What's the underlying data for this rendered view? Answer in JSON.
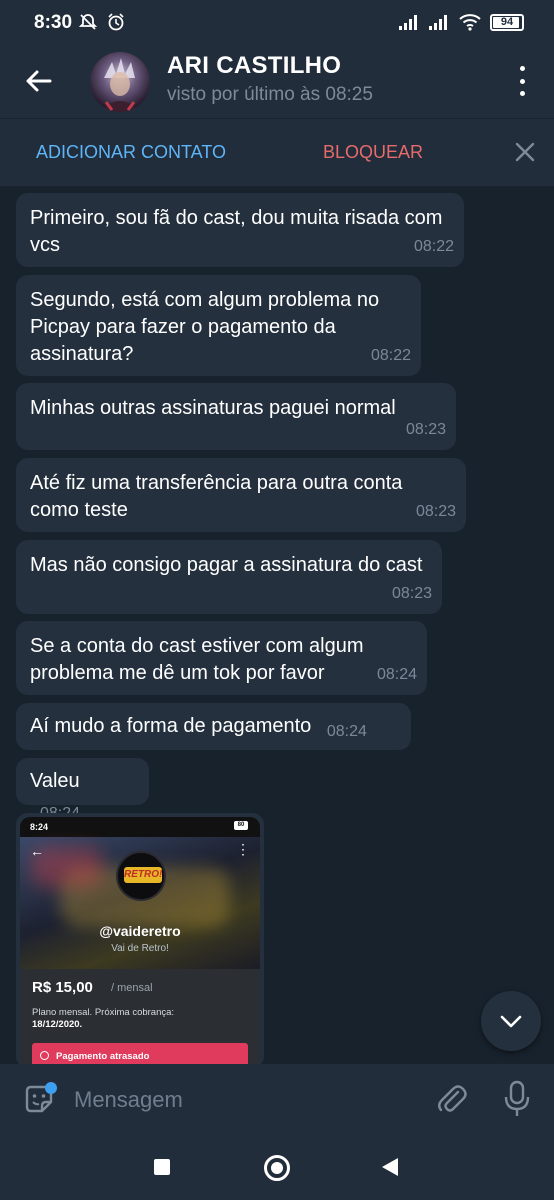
{
  "status_bar": {
    "time": "8:30",
    "battery": "94",
    "battery_level": 0.94,
    "icons": [
      "mute-notifications-icon",
      "alarm-icon",
      "signal-icon",
      "signal-icon",
      "wifi-icon",
      "battery-icon"
    ]
  },
  "header": {
    "contact_name": "ARI CASTILHO",
    "last_seen": "visto por último às 08:25"
  },
  "action_bar": {
    "add_contact": "ADICIONAR CONTATO",
    "block": "BLOQUEAR"
  },
  "messages": [
    {
      "text": "Primeiro, sou fã do cast, dou muita risada com vcs",
      "time": "08:22"
    },
    {
      "text": "Segundo, está com algum problema no Picpay para fazer o pagamento da assinatura?",
      "time": "08:22"
    },
    {
      "text": "Minhas outras assinaturas paguei normal",
      "time": "08:23"
    },
    {
      "text": "Até fiz uma transferência para outra conta como teste",
      "time": "08:23"
    },
    {
      "text": "Mas não consigo pagar a assinatura do cast",
      "time": "08:23"
    },
    {
      "text": "Se a conta do cast estiver com algum problema me dê um tok por favor",
      "time": "08:24"
    },
    {
      "text": "Aí mudo a forma de pagamento",
      "time": "08:24"
    },
    {
      "text": "Valeu",
      "time": "08:24"
    }
  ],
  "image_message": {
    "status_time": "8:24",
    "status_battery": "80",
    "logo_text": "RETRO!",
    "handle": "@vaideretro",
    "name": "Vai de Retro!",
    "price": "R$ 15,00",
    "period": "/ mensal",
    "description": "Plano mensal. Próxima cobrança:",
    "next_charge": "18/12/2020.",
    "alert": "Pagamento atrasado"
  },
  "composer": {
    "placeholder": "Mensagem"
  },
  "colors": {
    "background": "#18222d",
    "bar": "#212d3b",
    "bubble": "#25303e",
    "accent_blue": "#5eb5f7",
    "accent_red": "#e66b6b"
  }
}
